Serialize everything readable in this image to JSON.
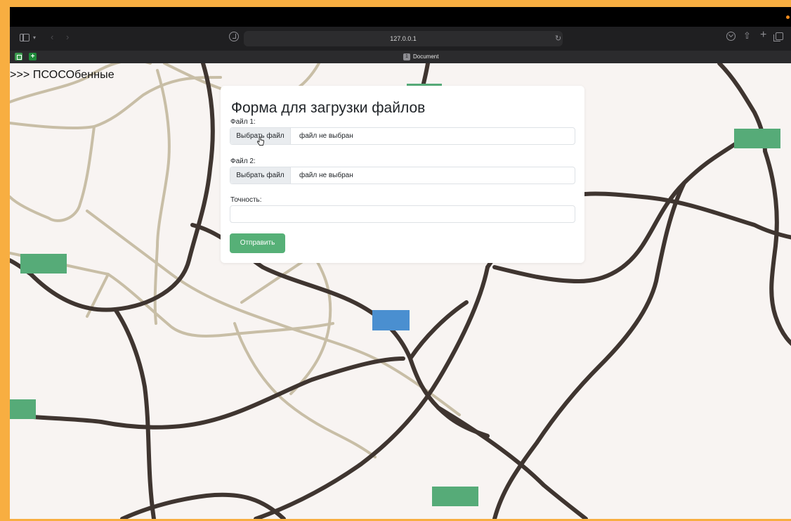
{
  "browser": {
    "url": "127.0.0.1",
    "tab_title": "Document",
    "tab_badge": "1"
  },
  "page": {
    "site_title": ">>> ПСОСОбенные"
  },
  "form": {
    "heading": "Форма для загрузки файлов",
    "file1_label": "Файл 1:",
    "file2_label": "Файл 2:",
    "choose_button": "Выбрать файл",
    "no_file_text": "файл не выбран",
    "precision_label": "Точность:",
    "precision_value": "",
    "submit_label": "Отправить"
  },
  "colors": {
    "accent_green": "#56b077",
    "marker_blue": "#4a8fd0",
    "road_dark": "#3f3530",
    "road_light": "#c8bea6",
    "frame_orange": "#f8ae41"
  }
}
